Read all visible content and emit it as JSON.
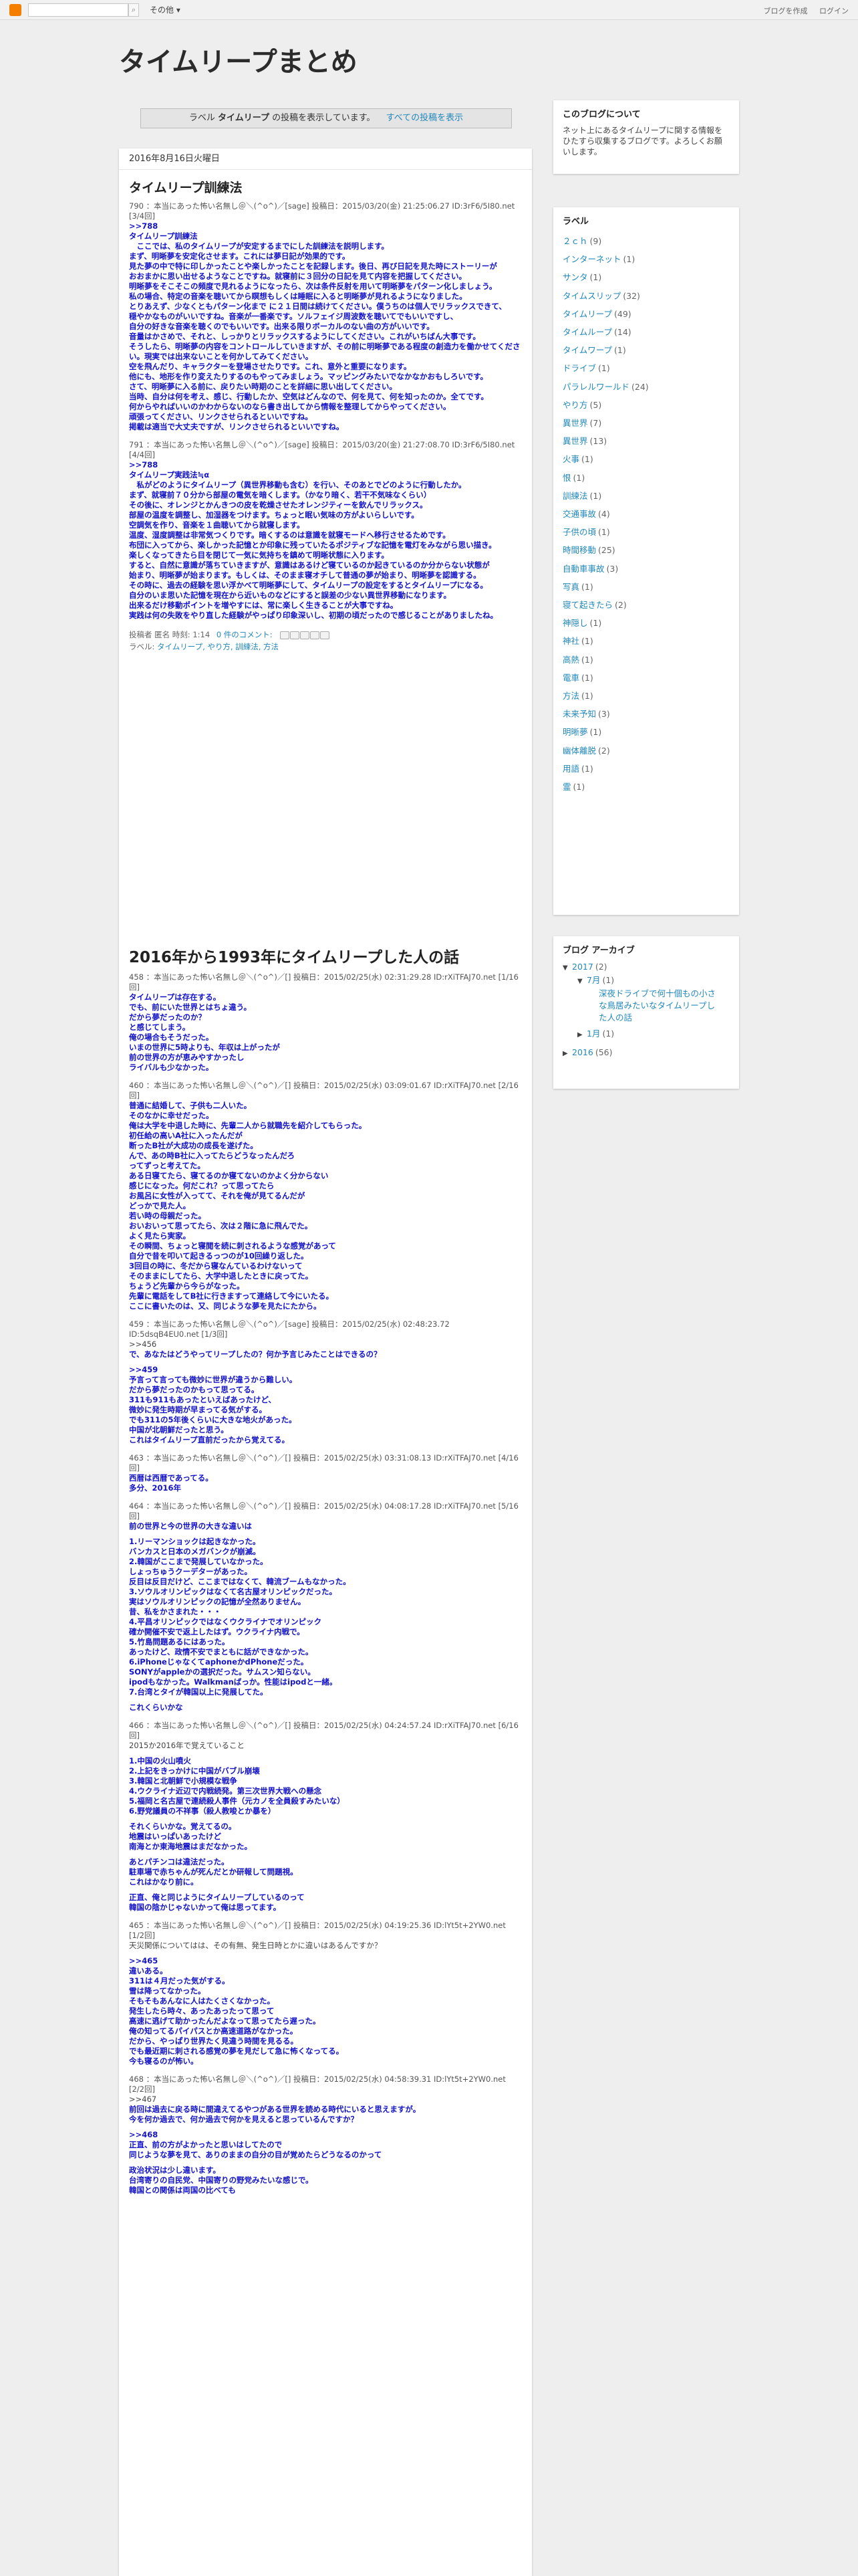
{
  "navbar": {
    "more_label": "その他",
    "right_links": [
      "ブログを作成",
      "ログイン"
    ]
  },
  "blog": {
    "title": "タイムリープまとめ"
  },
  "status_message": {
    "prefix": "ラベル",
    "label": "タイムリープ",
    "suffix": "の投稿を表示しています。",
    "show_all": "すべての投稿を表示"
  },
  "date_header": "2016年8月16日火曜日",
  "post1": {
    "title": "タイムリープ訓練法",
    "res1_head": "790 ：本当にあった怖い名無し＠＼(^o^)／[sage] 投稿日：2015/03/20(金) 21:25:06.27 ID:3rF6/5I80.net [3/4回]",
    "res1_lines": [
      ">>788",
      "タイムリープ訓練法",
      "　ここでは、私のタイムリープが安定するまでにした訓練法を説明します。",
      "まず、明晰夢を安定化させます。これには夢日記が効果的です。",
      "見た夢の中で特に印しかったことや楽しかったことを記録します。後日、再び日記を見た時にストーリーが",
      "おおまかに思い出せるようなことですね。就寝前に３回分の日記を見て内容を把握してください。",
      "明晰夢をそこそこの頻度で見れるようになったら、次は条件反射を用いて明晰夢をパターン化しましょう。",
      "私の場合、特定の音楽を聴いてから瞑想もしくは睡眠に入ると明晰夢が見れるようになりました。",
      "とりあえず、少なくともパターン化まで に２１日間は続けてください。僕うちのは個人でリラックスできて、",
      "穏やかなものがいいですね。音楽が一番楽です。ソルフェイジ周波数を聴いてでもいいですし、",
      "自分の好きな音楽を聴くのでもいいです。出来る限りボーカルのない曲の方がいいです。",
      "音量はかさめで、それと、しっかりとリラックスするようにしてください。これがいちばん大事です。",
      "そうしたら、明晰夢の内容をコントロールしていきますが、その前に明晰夢である程度の創造力を働かせてください。現実では出来ないことを何かしてみてください。",
      "空を飛んだり、キャラクターを登場させたりです。これ、意外と重要になります。",
      "他にも、地形を作り変えたりするのもやってみましょう。マッピングみたいでなかなかおもしろいです。",
      "さて、明晰夢に入る前に、戻りたい時期のことを詳細に思い出してください。",
      "当時、自分は何を考え、感じ、行動したか、空気はどんなので、何を見て、何を知ったのか。全てです。",
      "何からやればいいのかわからないのなら書き出してから情報を整理してからやってください。",
      "頑張ってください、リンクさせられるといいですね。",
      "掲載は適当で大丈夫ですが、リンクさせられるといいですね。"
    ],
    "res2_head": "791 ：本当にあった怖い名無し＠＼(^o^)／[sage] 投稿日：2015/03/20(金) 21:27:08.70 ID:3rF6/5I80.net [4/4回]",
    "res2_lines": [
      ">>788",
      "タイムリープ実践法≒α",
      "　私がどのようにタイムリープ（異世界移動も含む）を行い、そのあとでどのように行動したか。",
      "まず、就寝前７０分から部屋の電気を暗くします。（かなり暗く、若干不気味なくらい）",
      "その後に、オレンジとかんきつの皮を乾燥させたオレンジティーを飲んでリラックス。",
      "部屋の温度を調整し、加湿器をつけます。ちょっと眠い気味の方がよいらしいです。",
      "空調気を作り、音楽を１曲聴いてから就寝します。",
      "温度、湿度調整は非常気つくりです。暗くするのは意識を就寝モードへ移行させるためです。",
      "布団に入ってから、楽しかった記憶とか印象に残っていたるポジティブな記憶を電灯をみながら思い描き。",
      "楽しくなってきたら目を閉じて一気に気持ちを鎮めて明晰状態に入ります。",
      "すると、自然に意識が落ちていきますが、意識はあるけど寝ているのか起きているのか分からない状態が",
      "始まり、明晰夢が始まります。もしくは、そのまま寝オチして普通の夢が始まり、明晰夢を認識する。",
      "その時に、過去の経験を思い浮かべて明晰夢にして、タイムリープの設定をするとタイムリープになる。",
      "自分のいま思いた記憶を現在から近いものなどにすると誤差の少ない異世界移動になります。",
      "出来るだけ移動ポイントを増やすには、常に楽しく生きることが大事ですね。",
      "実践は何の失敗をやり直した経験がやっぱり印象深いし、初期の頃だったので感じることがありましたね。"
    ],
    "footer_posted": "投稿者 匿名 時刻: 1:14",
    "footer_comments": "0 件のコメント:",
    "footer_labels_prefix": "ラベル:",
    "footer_labels": "タイムリープ, やり方, 訓練法, 方法"
  },
  "post2": {
    "title": "2016年から1993年にタイムリープした人の話",
    "res": [
      {
        "head": "458 ：本当にあった怖い名無し＠＼(^o^)／[] 投稿日：2015/02/25(水) 02:31:29.28 ID:rXiTFAJ70.net [1/16回]",
        "lines": [
          "タイムリープは存在する。",
          "でも、前にいた世界とはちょ違う。",
          "だから夢だったのか？",
          "と感じてしまう。",
          "俺の場合もそうだった。",
          "いまの世界に5時よりも、年収は上がったが",
          "前の世界の方が恵みやすかったし",
          "ライバルも少なかった。"
        ]
      },
      {
        "head": "460 ：本当にあった怖い名無し＠＼(^o^)／[] 投稿日：2015/02/25(水) 03:09:01.67 ID:rXiTFAJ70.net [2/16回]",
        "lines": [
          "普通に結婚して、子供も二人いた。",
          "そのなかに幸せだった。",
          "俺は大学を中退した時に、先輩二人から就職先を紹介してもらった。",
          "初任給の高いA社に入ったんだが",
          "断ったB社が大成功の成長を遂げた。",
          "んで、あの時B社に入ってたらどうなったんだろ",
          "ってずっと考えてた。",
          "ある日寝てたら、寝てるのか寝てないのかよく分からない",
          "感じになった。何だこれ？って思ってたら",
          "お風呂に女性が入ってて、それを俺が見てるんだが",
          "どっかで見た人。",
          "若い時の母親だった。",
          "おいおいって思ってたら、次は２階に急に飛んでた。",
          "よく見たら実家。",
          "その瞬間、ちょっと寝閲を続に刺されるような感覚があって",
          "自分で昔を叩いて起きるっつのが10回繰り返した。",
          "3回目の時に、冬だから寝なんているわけないって",
          "そのままにしてたら、大学中退したときに戻ってた。",
          "ちょうど先輩から今らがなった。",
          "先輩に電話をしてB社に行きますって連絡して今にいたる。",
          "ここに書いたのは、又、同じような夢を見たにたから。"
        ]
      },
      {
        "head": "459 ：本当にあった怖い名無し＠＼(^o^)／[sage] 投稿日：2015/02/25(水) 02:48:23.72 ID:5dsqB4EU0.net [1/3回]",
        "lines": [
          "~>>456",
          "で、あなたはどうやってリープしたの？何か予言じみたことはできるの？",
          "",
          ">>459",
          "予言って言っても微妙に世界が違うから難しい。",
          "だから夢だったのかもって思ってる。",
          "311も911もあったといえばあったけど、",
          "微妙に発生時期が早まってる気がする。",
          "でも311の5年後くらいに大きな地火があった。",
          "中国が北朝鮮だったと思う。",
          "これはタイムリープ直前だったから覚えてる。"
        ]
      },
      {
        "head": "463 ：本当にあった怖い名無し＠＼(^o^)／[] 投稿日：2015/02/25(水) 03:31:08.13 ID:rXiTFAJ70.net [4/16回]",
        "lines": [
          "西暦は西暦であってる。",
          "多分、2016年"
        ]
      },
      {
        "head": "464 ：本当にあった怖い名無し＠＼(^o^)／[] 投稿日：2015/02/25(水) 04:08:17.28 ID:rXiTFAJ70.net [5/16回]",
        "lines": [
          "前の世界と今の世界の大きな違いは",
          "",
          "1.リーマンショックは起きなかった。",
          "バンカスと日本のメガバンクが崩滅。",
          "2.韓国がここまで発展していなかった。",
          "しょっちゅうクーデターがあった。",
          "反目は反目だけど、ここまではなくて、韓流ブームもなかった。",
          "3.ソウルオリンピックはなくて名古屋オリンピックだった。",
          "実はソウルオリンピックの記憶が全然ありません。",
          "昔、私をかさまれた・・・",
          "4.平昌オリンピックではなくウクライナでオリンピック",
          "確か開催不安で返上したはず。ウクライナ内戦で。",
          "5.竹島問題あるにはあった。",
          "あったけど、政情不安でまともに話ができなかった。",
          "6.iPhoneじゃなくてaphoneかdPhoneだった。",
          "SONYがappleかの選択だった。サムスン知らない。",
          "ipodもなかった。Walkmanばっか。性能はipodと一緒。",
          "7.台湾とタイが韓国以上に発展してた。",
          "",
          "これくらいかな"
        ]
      },
      {
        "head": "466 ：本当にあった怖い名無し＠＼(^o^)／[] 投稿日：2015/02/25(水) 04:24:57.24 ID:rXiTFAJ70.net [6/16回]",
        "lines": [
          "~2015か2016年で覚えていること",
          "",
          "1.中国の火山噴火",
          "2.上記をきっかけに中国がバブル崩壊",
          "3.韓国と北朝鮮で小規模な戦争",
          "4.ウクライナ近辺で内戦続発。第三次世界大戦への懸念",
          "5.福岡と名古屋で連続殺人事件（元カノを全員殺すみたいな）",
          "6.野党議員の不祥事（殺人教唆とか暴を）",
          "",
          "それくらいかな。覚えてるの。",
          "地震はいっぱいあったけど",
          "南海とか東海地震はまだなかった。",
          "",
          "あとパチンコは違法だった。",
          "駐車場で赤ちゃんが死んだとか研報して問題視。",
          "これはかなり前に。",
          "",
          "正直、俺と同じようにタイムリープしているのって",
          "韓国の陰かじゃないかって俺は思ってます。"
        ]
      },
      {
        "head": "465 ：本当にあった怖い名無し＠＼(^o^)／[] 投稿日：2015/02/25(水) 04:19:25.36 ID:lYt5t+2YW0.net [1/2回]",
        "lines": [
          "~天災関係についてはは、その有無、発生日時とかに違いはあるんですか？",
          "",
          ">>465",
          "違いある。",
          "311は４月だった気がする。",
          "雪は降ってなかった。",
          "そもそもあんなに人はたくさくなかった。",
          "発生したら時々、あったあったって思って",
          "高速に逃げて助かったんだよなって思ってたら遅った。",
          "俺の知ってるパイパスとか高速道路がなかった。",
          "だから、やっぱり世界たく見違う時間を見るる。",
          "でも最近期に刺される感覚の夢を見だして急に怖くなってる。",
          "今も寝るのが怖い。"
        ]
      },
      {
        "head": "468 ：本当にあった怖い名無し＠＼(^o^)／[] 投稿日：2015/02/25(水) 04:58:39.31 ID:lYt5t+2YW0.net [2/2回]",
        "lines": [
          "~>>467",
          "前回は過去に戻る時に間違えてるやつがある世界を読める時代にいると思えますが。",
          "今を何か過去で、何か過去で何かを見えると思っているんですか？",
          "",
          ">>468",
          "正直、前の方がよかったと思いはしてたので",
          "同じような夢を見て、ありのままの自分の目が覚めたらどうなるのかって",
          "",
          "政治状況は少し違います。",
          "台湾寄りの自民党、中国寄りの野党みたいな感じで。",
          "韓国との関係は両国の比べても"
        ]
      }
    ]
  },
  "sidebar": {
    "about": {
      "title": "このブログについて",
      "text": "ネット上にあるタイムリープに関する情報をひたすら収集するブログです。よろしくお願いします。"
    },
    "labels": {
      "title": "ラベル",
      "items": [
        {
          "name": "２ｃｈ",
          "count": "(9)"
        },
        {
          "name": "インターネット",
          "count": "(1)"
        },
        {
          "name": "サンタ",
          "count": "(1)"
        },
        {
          "name": "タイムスリップ",
          "count": "(32)"
        },
        {
          "name": "タイムリープ",
          "count": "(49)"
        },
        {
          "name": "タイムループ",
          "count": "(14)"
        },
        {
          "name": "タイムワープ",
          "count": "(1)"
        },
        {
          "name": "ドライブ",
          "count": "(1)"
        },
        {
          "name": "パラレルワールド",
          "count": "(24)"
        },
        {
          "name": "やり方",
          "count": "(5)"
        },
        {
          "name": "異世界",
          "count": "(7)"
        },
        {
          "name": "異世界",
          "count": "(13)"
        },
        {
          "name": "火事",
          "count": "(1)"
        },
        {
          "name": "恨",
          "count": "(1)"
        },
        {
          "name": "訓練法",
          "count": "(1)"
        },
        {
          "name": "交通事故",
          "count": "(4)"
        },
        {
          "name": "子供の頃",
          "count": "(1)"
        },
        {
          "name": "時間移動",
          "count": "(25)"
        },
        {
          "name": "自動車事故",
          "count": "(3)"
        },
        {
          "name": "写真",
          "count": "(1)"
        },
        {
          "name": "寝て起きたら",
          "count": "(2)"
        },
        {
          "name": "神隠し",
          "count": "(1)"
        },
        {
          "name": "神社",
          "count": "(1)"
        },
        {
          "name": "高熱",
          "count": "(1)"
        },
        {
          "name": "電車",
          "count": "(1)"
        },
        {
          "name": "方法",
          "count": "(1)"
        },
        {
          "name": "未来予知",
          "count": "(3)"
        },
        {
          "name": "明晰夢",
          "count": "(1)"
        },
        {
          "name": "幽体離脱",
          "count": "(2)"
        },
        {
          "name": "用語",
          "count": "(1)"
        },
        {
          "name": "霊",
          "count": "(1)"
        }
      ]
    },
    "archive": {
      "title": "ブログ アーカイブ",
      "year_2017": "2017",
      "year_2017_count": "(2)",
      "month_7": "7月",
      "month_7_count": "(1)",
      "post_link": "深夜ドライブで何十個もの小さな鳥居みたいなタイムリープした人の話",
      "month_1": "1月",
      "month_1_count": "(1)",
      "year_2016": "2016",
      "year_2016_count": "(56)"
    }
  }
}
